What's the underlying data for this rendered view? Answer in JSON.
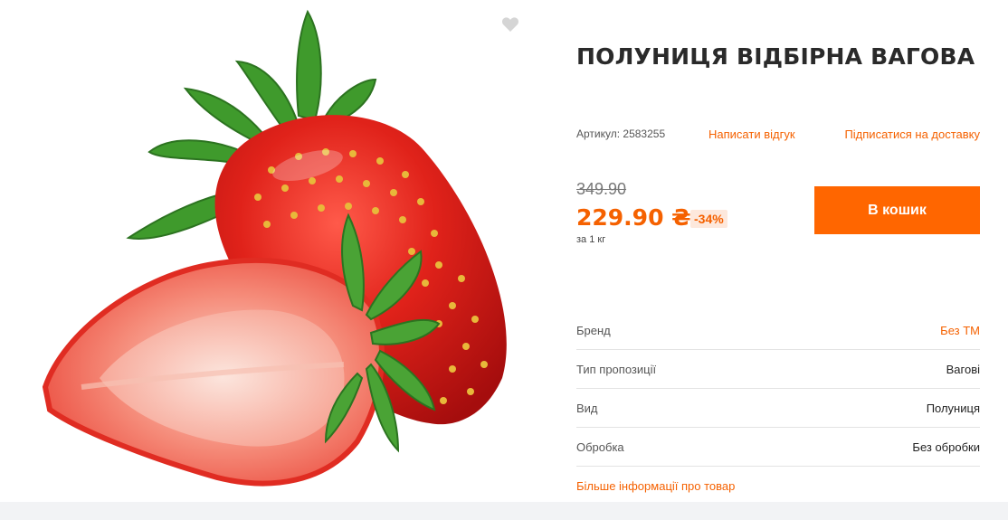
{
  "product": {
    "title": "ПОЛУНИЦЯ ВІДБІРНА ВАГОВА",
    "image_alt": "strawberry"
  },
  "meta": {
    "article": "Артикул: 2583255",
    "write_review": "Написати відгук",
    "subscribe": "Підписатися на доставку"
  },
  "pricing": {
    "old_price": "349.90",
    "price": "229.90 ₴",
    "discount": "-34%",
    "unit": "за 1 кг"
  },
  "cart": {
    "button_label": "В кошик"
  },
  "specs": [
    {
      "name": "Бренд",
      "value": "Без ТМ",
      "is_link": true
    },
    {
      "name": "Тип пропозиції",
      "value": "Вагові",
      "is_link": false
    },
    {
      "name": "Вид",
      "value": "Полуниця",
      "is_link": false
    },
    {
      "name": "Обробка",
      "value": "Без обробки",
      "is_link": false
    }
  ],
  "more_info": "Більше інформації про товар",
  "colors": {
    "accent": "#ff6600",
    "link": "#f56100",
    "discount_bg": "#fde8dc",
    "fav_icon": "#d5d5d5"
  },
  "icons": {
    "favorite": "heart-icon"
  }
}
